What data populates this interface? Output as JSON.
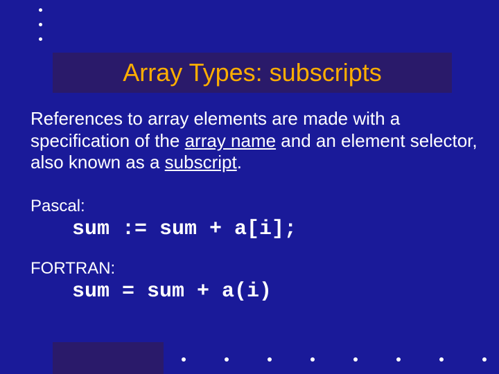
{
  "title": "Array Types: subscripts",
  "paragraph": {
    "pre1": "References to array elements are made with a specification of the ",
    "u1": "array name",
    "mid": " and an element selector, also known as a ",
    "u2": "subscript",
    "post": "."
  },
  "examples": [
    {
      "label": "Pascal:",
      "code": "sum := sum + a[i];"
    },
    {
      "label": "FORTRAN:",
      "code": "sum = sum + a(i)"
    }
  ]
}
